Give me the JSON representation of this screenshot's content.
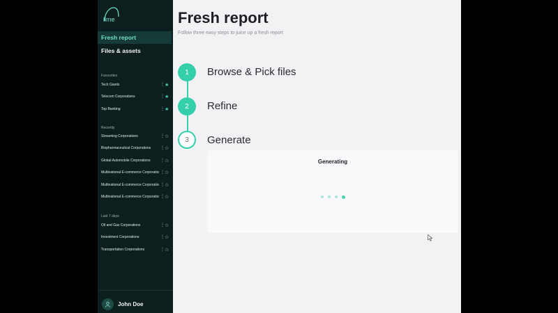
{
  "logo_text": "lime",
  "nav": [
    {
      "label": "Fresh report",
      "active": true
    },
    {
      "label": "Files & assets",
      "active": false
    }
  ],
  "favourites": {
    "label": "Favourites",
    "items": [
      {
        "label": "Tech Giants",
        "starred": true
      },
      {
        "label": "Telecom Corporations",
        "starred": true
      },
      {
        "label": "Top Banking",
        "starred": true
      }
    ]
  },
  "recently": {
    "label": "Recently",
    "items": [
      {
        "label": "Streaming Corporations",
        "starred": false
      },
      {
        "label": "Biopharmaceutical Corporations",
        "starred": false
      },
      {
        "label": "Global Automobile Corporations",
        "starred": false
      },
      {
        "label": "Multinational E-commerce Corporations",
        "starred": false
      },
      {
        "label": "Multinational E-commerce Corporations",
        "starred": false
      },
      {
        "label": "Multinational E-commerce Corporations",
        "starred": false
      }
    ]
  },
  "last7": {
    "label": "Last 7 days",
    "items": [
      {
        "label": "Oil and Gas Corporations",
        "starred": false
      },
      {
        "label": "Investment Corporations",
        "starred": false
      },
      {
        "label": "Transportation Corporations",
        "starred": false
      }
    ]
  },
  "user": {
    "name": "John Doe"
  },
  "main": {
    "title": "Fresh report",
    "subtitle": "Follow three easy steps to juice up a fresh report",
    "steps": [
      {
        "number": "1",
        "label": "Browse & Pick files",
        "state": "done"
      },
      {
        "number": "2",
        "label": "Refine",
        "state": "done"
      },
      {
        "number": "3",
        "label": "Generate",
        "state": "current"
      }
    ],
    "card": {
      "title": "Generating"
    }
  },
  "colors": {
    "accent": "#36cfab",
    "sidebar": "#0c1e1e",
    "main_bg": "#f2f1f3"
  }
}
